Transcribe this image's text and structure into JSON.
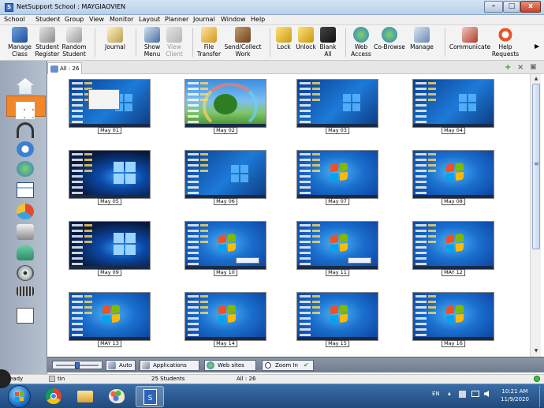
{
  "window": {
    "title": "NetSupport School : MAYGIAOVIEN",
    "minimize_glyph": "–",
    "maximize_glyph": "□",
    "close_glyph": "x"
  },
  "menubar": [
    "School",
    "Student",
    "Group",
    "View",
    "Monitor",
    "Layout",
    "Planner",
    "Journal",
    "Window",
    "Help"
  ],
  "toolbar": {
    "items": [
      {
        "label": "Manage Class",
        "icon": "manage-class-icon"
      },
      {
        "label": "Student Register",
        "icon": "student-register-icon"
      },
      {
        "label": "Random Student",
        "icon": "random-student-icon"
      },
      {
        "label": "Journal",
        "icon": "journal-icon"
      },
      {
        "label": "Show Menu",
        "icon": "show-menu-icon"
      },
      {
        "label": "View Client",
        "icon": "view-client-icon",
        "disabled": true
      },
      {
        "label": "File Transfer",
        "icon": "file-transfer-icon"
      },
      {
        "label": "Send/Collect Work",
        "icon": "send-collect-icon"
      },
      {
        "label": "Lock",
        "icon": "lock-icon"
      },
      {
        "label": "Unlock",
        "icon": "unlock-icon"
      },
      {
        "label": "Blank All",
        "icon": "blank-all-icon"
      },
      {
        "label": "Web Access",
        "icon": "web-access-icon"
      },
      {
        "label": "Co-Browse",
        "icon": "co-browse-icon"
      },
      {
        "label": "Manage",
        "icon": "manage-icon"
      },
      {
        "label": "Communicate",
        "icon": "communicate-icon"
      },
      {
        "label": "Help Requests",
        "icon": "help-requests-icon"
      }
    ],
    "more_glyph": "▶"
  },
  "sidebar": {
    "icons": [
      "home-icon",
      "thumbnail-view-icon",
      "headphones-icon",
      "help-question-icon",
      "globe-icon",
      "monitor-list-icon",
      "pie-chart-icon",
      "printer-icon",
      "user-group-icon",
      "disc-icon",
      "keyboard-icon",
      "chart-line-icon"
    ]
  },
  "tab": {
    "label": "All : 26",
    "add_glyph": "+",
    "close_glyph": "×",
    "restore_glyph": "▣"
  },
  "students": [
    {
      "name": "May 01",
      "screen": "desk-dialog"
    },
    {
      "name": "May 02",
      "screen": "rainbow"
    },
    {
      "name": "May 03",
      "screen": "win10"
    },
    {
      "name": "May 04",
      "screen": "win10"
    },
    {
      "name": "May 05",
      "screen": "dark10"
    },
    {
      "name": "May 06",
      "screen": "win10"
    },
    {
      "name": "May 07",
      "screen": "win7"
    },
    {
      "name": "May 08",
      "screen": "win7"
    },
    {
      "name": "May 09",
      "screen": "dark10"
    },
    {
      "name": "May 10",
      "screen": "win7-notice"
    },
    {
      "name": "May 11",
      "screen": "win7-notice"
    },
    {
      "name": "MAY 12",
      "screen": "win7"
    },
    {
      "name": "MAY 13",
      "screen": "win7"
    },
    {
      "name": "May 14",
      "screen": "win7"
    },
    {
      "name": "May 15",
      "screen": "win7"
    },
    {
      "name": "May 16",
      "screen": "win7"
    }
  ],
  "scrollbar": {
    "up_glyph": "▲",
    "down_glyph": "▼",
    "grip_glyph": "≡"
  },
  "bottombar": {
    "auto_label": "Auto",
    "applications_label": "Applications",
    "websites_label": "Web sites",
    "zoom_label": "Zoom In",
    "zoom_check_glyph": "✔"
  },
  "statusbar": {
    "ready": "eady",
    "user": "tin",
    "students_count": "25 Students",
    "all_count": "All : 26"
  },
  "taskbar": {
    "language": "EN",
    "tray_up_glyph": "▲",
    "time": "10:21 AM",
    "date": "11/9/2020"
  },
  "colors": {
    "sidebar_active": "#f0882b",
    "title_gradient_top": "#d4e3f5",
    "taskbar": "#1f4a7d"
  }
}
